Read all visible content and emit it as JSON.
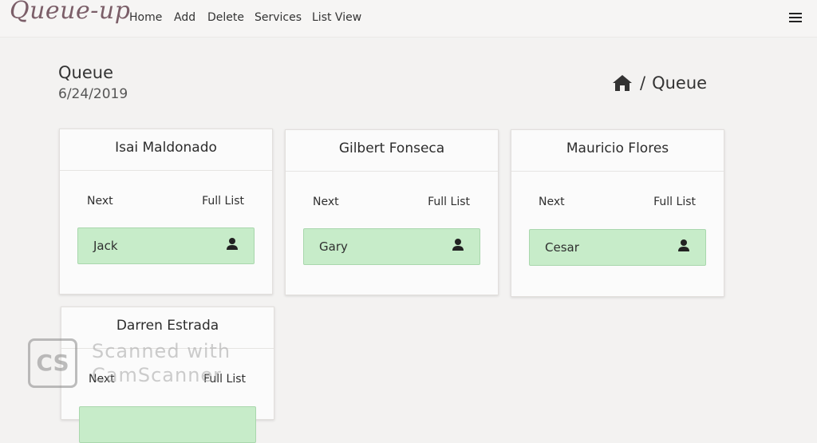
{
  "nav": {
    "brand": "Queue-up",
    "links": [
      "Home",
      "Add",
      "Delete",
      "Services",
      "List View"
    ]
  },
  "page": {
    "title": "Queue",
    "date": "6/24/2019"
  },
  "breadcrumb": {
    "home_icon": "home-icon",
    "separator": "/",
    "current": "Queue"
  },
  "cards": [
    {
      "name": "Isai Maldonado",
      "next_label": "Next",
      "full_list_label": "Full List",
      "next_person": "Jack"
    },
    {
      "name": "Gilbert Fonseca",
      "next_label": "Next",
      "full_list_label": "Full List",
      "next_person": "Gary"
    },
    {
      "name": "Mauricio Flores",
      "next_label": "Next",
      "full_list_label": "Full List",
      "next_person": "Cesar"
    },
    {
      "name": "Darren Estrada",
      "next_label": "Next",
      "full_list_label": "Full List",
      "next_person": ""
    }
  ],
  "watermark": {
    "logo_text": "CS",
    "line1": "Scanned with",
    "line2": "CamScanner"
  },
  "colors": {
    "brand": "#7b5e68",
    "person_bg": "#c7ecc9",
    "person_border": "#a9d7ad"
  }
}
